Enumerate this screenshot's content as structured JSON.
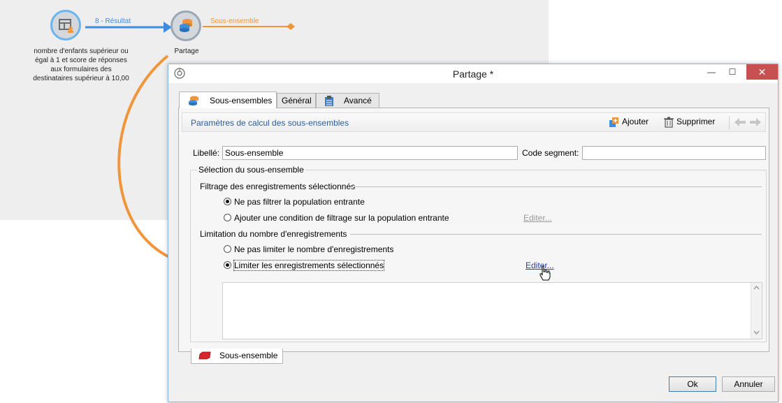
{
  "canvas": {
    "node1": {
      "icon": "query-icon",
      "label_lines": [
        "nombre d'enfants supérieur ou",
        "égal à 1 et score de réponses",
        "aux formulaires des",
        "destinataires supérieur à 10,00"
      ]
    },
    "transition1": {
      "label": "8 - Résultat"
    },
    "node2": {
      "icon": "split-icon",
      "label": "Partage"
    },
    "transition2": {
      "label": "Sous-ensemble"
    },
    "colors": {
      "blue": "#3b8de0",
      "orange": "#f0953a"
    }
  },
  "dialog": {
    "title": "Partage *",
    "window_buttons": {
      "minimize": "—",
      "maximize": "☐",
      "close": "✕"
    },
    "tabs": [
      {
        "label": "Sous-ensembles",
        "icon": "database-icon"
      },
      {
        "label": "Général"
      },
      {
        "label": "Avancé",
        "icon": "clipboard-icon"
      }
    ],
    "sub_header": {
      "title": "Paramètres de calcul des sous-ensembles",
      "add_label": "Ajouter",
      "delete_label": "Supprimer"
    },
    "fields": {
      "libelle_label": "Libellé:",
      "libelle_value": "Sous-ensemble",
      "code_label": "Code segment:",
      "code_value": ""
    },
    "selection_group": "Sélection du sous-ensemble",
    "filtering": {
      "title": "Filtrage des enregistrements sélectionnés",
      "options": [
        "Ne pas filtrer la population entrante",
        "Ajouter une condition de filtrage sur la population entrante"
      ],
      "edit_link": "Editer..."
    },
    "limitation": {
      "title": "Limitation du nombre d'enregistrements",
      "options": [
        "Ne pas limiter le nombre d'enregistrements",
        "Limiter les enregistrements sélectionnés"
      ],
      "edit_link": "Editer..."
    },
    "bottom_tab": {
      "label": "Sous-ensemble"
    },
    "buttons": {
      "ok": "Ok",
      "cancel": "Annuler"
    }
  }
}
